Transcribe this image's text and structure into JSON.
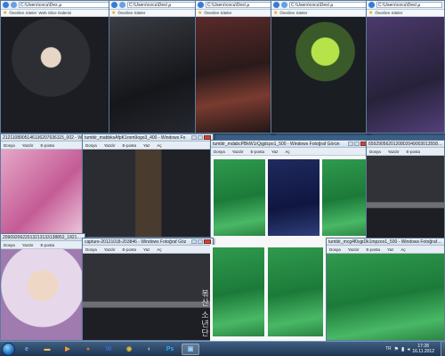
{
  "colors": {
    "desktop": "#3a5f86",
    "taskbar": "#1f3552",
    "close_button": "#c9483a"
  },
  "browser_windows": [
    {
      "url": "C:\\Users\\cocu\\Des ⍴",
      "favorites": [
        "Önerilen Siteler",
        "Web Slice Galerisi"
      ]
    },
    {
      "url": "C:\\Users\\cocu\\Desl ⍴",
      "favorites": [
        "Önerilen Siteler"
      ]
    },
    {
      "url": "C:\\Users\\cocu\\Desl ⍴",
      "favorites": [
        "Önerilen Siteler"
      ]
    },
    {
      "url": "C:\\Users\\cocu\\Desl ⍴",
      "favorites": [
        "Önerilen Siteler"
      ]
    },
    {
      "url": "C:\\Users\\cocu\\Desl ⍴",
      "favorites": [
        "Önerilen Siteler"
      ]
    }
  ],
  "viewer_windows": [
    {
      "title": "2121108905146136207636115_002 - W",
      "menu": [
        "Dosya",
        "Yazdır",
        "E-posta"
      ]
    },
    {
      "title": "tumblr_mabbksAfpK1rom9ogo3_400 - Windows Fo",
      "menu": [
        "Dosya",
        "Yazdır",
        "E-posta",
        "Yaz",
        "Aç"
      ]
    },
    {
      "title": "tumblr_mdabcPBkW1rQqjdcpo1_500 - Windows Fotoğraf Görün",
      "menu": [
        "Dosya",
        "Yazdır",
        "E-posta",
        "Yaz",
        "Aç"
      ]
    },
    {
      "title": "659290562012080204900301355892",
      "menu": [
        "Dosya",
        "Yazdır",
        "E-posta"
      ]
    },
    {
      "title": "2090920622013213133138852_1821_00",
      "menu": [
        "Dosya",
        "Yazdır",
        "E-posta"
      ]
    },
    {
      "title": "capture-20121018-203846 - Windows Fotoğraf Göz",
      "menu": [
        "Dosya",
        "Yazdır",
        "E-posta",
        "Yaz",
        "Aç"
      ]
    },
    {
      "title": "tumblr_mcg4f0sjpDk1mpzoo1_500 - Windows Fotoğraf Göre",
      "menu": [
        "Dosya",
        "Yazdır",
        "E-posta",
        "Yaz",
        "Aç"
      ]
    }
  ],
  "photo_caption": "볶산 소년단",
  "taskbar": {
    "apps": [
      {
        "icon": "ie-icon",
        "glyph": "e",
        "color": "#5cb3ff"
      },
      {
        "icon": "folder-icon",
        "glyph": "▬",
        "color": "#f2c14e"
      },
      {
        "icon": "media-player-icon",
        "glyph": "▶",
        "color": "#ff9a2e"
      },
      {
        "icon": "firefox-icon",
        "glyph": "●",
        "color": "#e36b22"
      },
      {
        "icon": "word-icon",
        "glyph": "W",
        "color": "#2f6fd1"
      },
      {
        "icon": "chrome-icon",
        "glyph": "◉",
        "color": "#e0c030"
      },
      {
        "icon": "media-icon",
        "glyph": "◐",
        "color": "#c0c0c0"
      },
      {
        "icon": "photoshop-icon",
        "glyph": "Ps",
        "color": "#31a8ff"
      },
      {
        "icon": "photo-viewer-icon",
        "glyph": "▣",
        "color": "#8fd3ff"
      }
    ],
    "language": "TR",
    "time": "17:28",
    "date": "16.11.2012"
  }
}
